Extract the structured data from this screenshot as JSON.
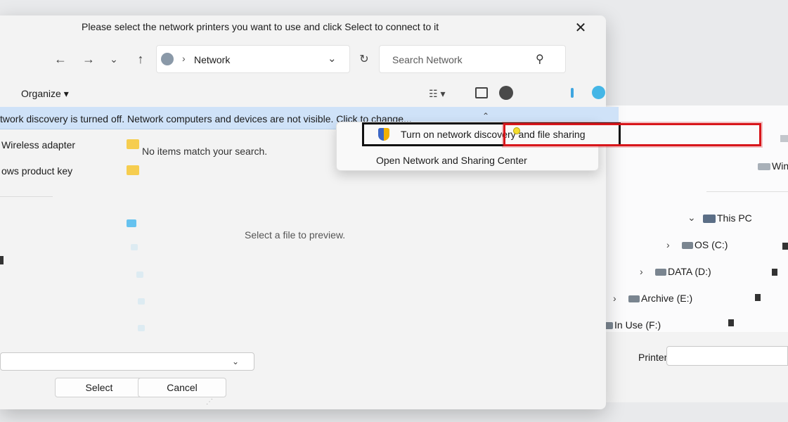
{
  "dialog": {
    "title": "Please select the network printers you want to use and click Select to connect to it",
    "address": "Network",
    "search_placeholder": "Search Network",
    "organize": "Organize",
    "infobar": "twork discovery is turned off. Network computers and devices are not visible. Click to change...",
    "empty_message": "No items match your search.",
    "preview_message": "Select a file to preview.",
    "select_button": "Select",
    "cancel_button": "Cancel"
  },
  "nav_pane": {
    "items": [
      "Wireless adapter",
      "ows product key"
    ]
  },
  "flyout": {
    "item1": "Turn on network discovery and file sharing",
    "item2": "Open Network and Sharing Center"
  },
  "background_window": {
    "right_item": "Windo",
    "tree": {
      "this_pc": "This PC",
      "drives": [
        "OS (C:)",
        "DATA (D:)",
        "Archive (E:)",
        "In Use (F:)"
      ]
    },
    "printer_label": "Printer"
  },
  "colors": {
    "highlight_red": "#d8161b",
    "infobar_blue": "#cfe2f8",
    "folder_yellow": "#f6cd4f"
  },
  "icons": {
    "close": "close-icon",
    "back": "back-arrow-icon",
    "forward": "forward-arrow-icon",
    "recent": "chevron-down-icon",
    "up": "up-arrow-icon",
    "network": "network-icon",
    "refresh": "refresh-icon",
    "search": "search-icon",
    "shield": "uac-shield-icon"
  }
}
